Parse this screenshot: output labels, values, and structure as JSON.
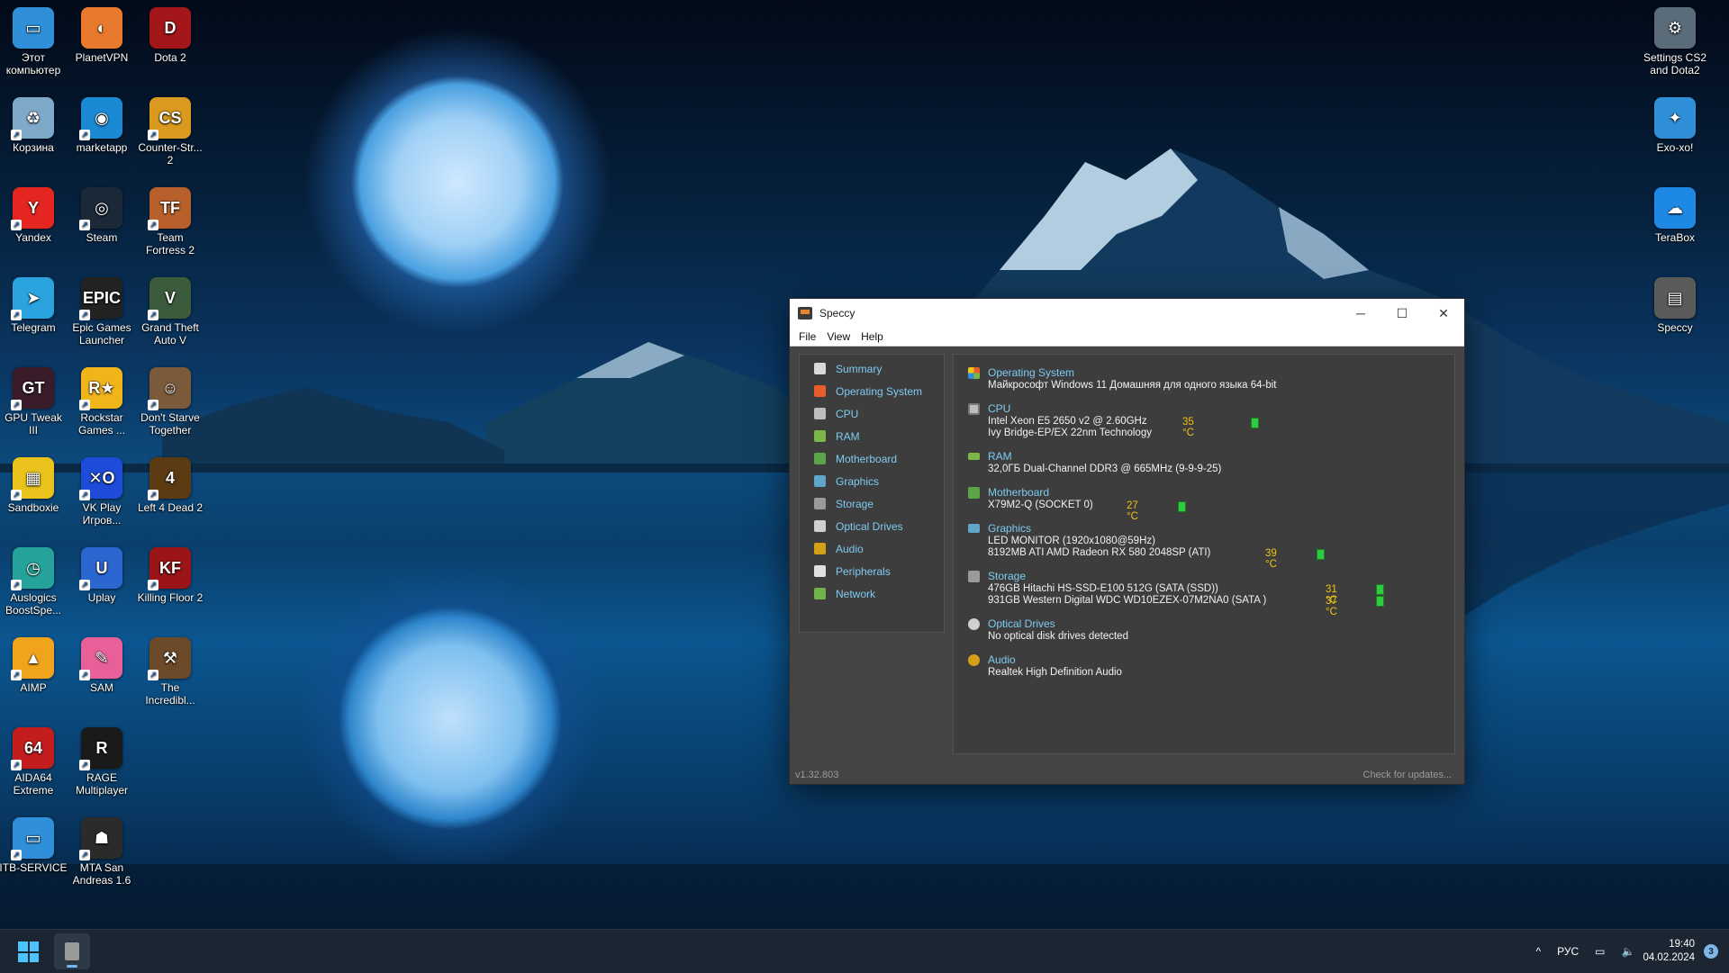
{
  "desktop": {
    "left_icons": [
      {
        "label": "Этот компьютер",
        "icon": "monitor-icon",
        "color": "#2f8fd8"
      },
      {
        "label": "PlanetVPN",
        "icon": "planetvpn-icon",
        "color": "#e87a2d"
      },
      {
        "label": "Dota 2",
        "icon": "dota2-icon",
        "color": "#a3161a"
      },
      {
        "label": "Корзина",
        "icon": "recycle-bin-icon",
        "color": "#7ea9c9"
      },
      {
        "label": "marketapp",
        "icon": "marketapp-icon",
        "color": "#1a8ad4"
      },
      {
        "label": "Counter-Str... 2",
        "icon": "counter-strike-icon",
        "color": "#d99a1f"
      },
      {
        "label": "Yandex",
        "icon": "yandex-icon",
        "color": "#e52620"
      },
      {
        "label": "Steam",
        "icon": "steam-icon",
        "color": "#1b2838"
      },
      {
        "label": "Team Fortress 2",
        "icon": "tf2-icon",
        "color": "#b8602b"
      },
      {
        "label": "Telegram",
        "icon": "telegram-icon",
        "color": "#2aa3de"
      },
      {
        "label": "Epic Games Launcher",
        "icon": "epic-games-icon",
        "color": "#222222"
      },
      {
        "label": "Grand Theft Auto V",
        "icon": "gta5-icon",
        "color": "#3c5a3c"
      },
      {
        "label": "GPU Tweak III",
        "icon": "gpu-tweak-icon",
        "color": "#3a1b2a"
      },
      {
        "label": "Rockstar Games ...",
        "icon": "rockstar-icon",
        "color": "#f1b51c"
      },
      {
        "label": "Don't Starve Together",
        "icon": "dont-starve-icon",
        "color": "#7a5a3a"
      },
      {
        "label": "Sandboxie",
        "icon": "sandboxie-icon",
        "color": "#e9c21b"
      },
      {
        "label": "VK Play Игров...",
        "icon": "vk-play-icon",
        "color": "#1e4bd8"
      },
      {
        "label": "Left 4 Dead 2",
        "icon": "left4dead2-icon",
        "color": "#5a3b12"
      },
      {
        "label": "Auslogics BoostSpe...",
        "icon": "auslogics-icon",
        "color": "#25a39a"
      },
      {
        "label": "Uplay",
        "icon": "uplay-icon",
        "color": "#2c66d1"
      },
      {
        "label": "Killing Floor 2",
        "icon": "killing-floor-icon",
        "color": "#9a1418"
      },
      {
        "label": "AIMP",
        "icon": "aimp-icon",
        "color": "#f0a41b"
      },
      {
        "label": "SAM",
        "icon": "sam-icon",
        "color": "#e8609a"
      },
      {
        "label": "The Incredibl...",
        "icon": "incredible-icon",
        "color": "#6b4a2a"
      },
      {
        "label": "AIDA64 Extreme",
        "icon": "aida64-icon",
        "color": "#c41d1d"
      },
      {
        "label": "RAGE Multiplayer",
        "icon": "rage-mp-icon",
        "color": "#1a1a1a"
      },
      {
        "label": "",
        "icon": "empty",
        "color": ""
      },
      {
        "label": "ITB-SERVICE",
        "icon": "itb-service-icon",
        "color": "#2f8fd8"
      },
      {
        "label": "MTA San Andreas 1.6",
        "icon": "mta-icon",
        "color": "#2b2b2b"
      }
    ],
    "right_icons": [
      {
        "label": "Settings CS2 and Dota2",
        "icon": "gear-icon",
        "color": "#5a6b7a"
      },
      {
        "label": "Exo-xo!",
        "icon": "exo-xo-icon",
        "color": "#2f8fd8"
      },
      {
        "label": "TeraBox",
        "icon": "terabox-icon",
        "color": "#1e88e5"
      },
      {
        "label": "Speccy",
        "icon": "speccy-icon",
        "color": "#5a5a5a"
      }
    ],
    "glyphs": {
      "monitor-icon": "▭",
      "planetvpn-icon": "◐",
      "dota2-icon": "D",
      "recycle-bin-icon": "♻",
      "marketapp-icon": "◉",
      "counter-strike-icon": "CS",
      "yandex-icon": "Y",
      "steam-icon": "◎",
      "tf2-icon": "TF",
      "telegram-icon": "➤",
      "epic-games-icon": "EPIC",
      "gta5-icon": "V",
      "gpu-tweak-icon": "GT",
      "rockstar-icon": "R★",
      "dont-starve-icon": "☺",
      "sandboxie-icon": "▦",
      "vk-play-icon": "✕O",
      "left4dead2-icon": "4",
      "auslogics-icon": "◷",
      "uplay-icon": "U",
      "killing-floor-icon": "KF",
      "aimp-icon": "▲",
      "sam-icon": "✎",
      "incredible-icon": "⚒",
      "aida64-icon": "64",
      "rage-mp-icon": "R",
      "itb-service-icon": "▭",
      "mta-icon": "☗",
      "gear-icon": "⚙",
      "exo-xo-icon": "✦",
      "terabox-icon": "☁",
      "speccy-icon": "▤"
    }
  },
  "window": {
    "title": "Speccy",
    "menu": [
      "File",
      "View",
      "Help"
    ],
    "version": "v1.32.803",
    "check_updates": "Check for updates...",
    "sidebar": [
      {
        "label": "Summary",
        "color": "#d9d9d9"
      },
      {
        "label": "Operating System",
        "color": "#e85d2b"
      },
      {
        "label": "CPU",
        "color": "#bdbdbd"
      },
      {
        "label": "RAM",
        "color": "#7ab648"
      },
      {
        "label": "Motherboard",
        "color": "#5aa44a"
      },
      {
        "label": "Graphics",
        "color": "#5fa6c9"
      },
      {
        "label": "Storage",
        "color": "#9a9a9a"
      },
      {
        "label": "Optical Drives",
        "color": "#d0d0d0"
      },
      {
        "label": "Audio",
        "color": "#d4a017"
      },
      {
        "label": "Peripherals",
        "color": "#e0e0e0"
      },
      {
        "label": "Network",
        "color": "#6fb34a"
      }
    ],
    "summary": {
      "os": {
        "title": "Operating System",
        "line1": "Майкрософт Windows 11 Домашняя для одного языка 64-bit"
      },
      "cpu": {
        "title": "CPU",
        "line1": "Intel Xeon E5 2650 v2 @ 2.60GHz",
        "temp": "35 °C",
        "line2": "Ivy Bridge-EP/EX 22nm Technology"
      },
      "ram": {
        "title": "RAM",
        "line1": "32,0ГБ Dual-Channel DDR3 @ 665MHz (9-9-9-25)"
      },
      "motherboard": {
        "title": "Motherboard",
        "line1": "X79M2-Q (SOCKET 0)",
        "temp": "27 °C"
      },
      "graphics": {
        "title": "Graphics",
        "line1": "LED MONITOR (1920x1080@59Hz)",
        "line2": "8192MB ATI AMD Radeon RX 580 2048SP (ATI)",
        "temp": "39 °C"
      },
      "storage": {
        "title": "Storage",
        "line1": "476GB Hitachi HS-SSD-E100 512G (SATA (SSD))",
        "temp1": "31 °C",
        "line2": "931GB Western Digital WDC WD10EZEX-07M2NA0 (SATA )",
        "temp2": "37 °C"
      },
      "optical": {
        "title": "Optical Drives",
        "line1": "No optical disk drives detected"
      },
      "audio": {
        "title": "Audio",
        "line1": "Realtek High Definition Audio"
      }
    }
  },
  "taskbar": {
    "language": "РУС",
    "time": "19:40",
    "date": "04.02.2024",
    "notifications": "3"
  }
}
